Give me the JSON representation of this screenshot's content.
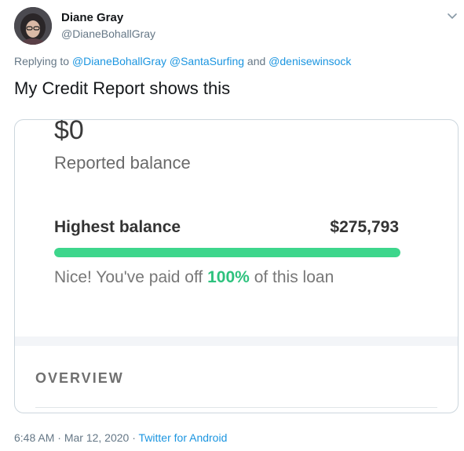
{
  "author": {
    "name": "Diane Gray",
    "handle": "@DianeBohallGray"
  },
  "reply": {
    "prefix": "Replying to",
    "mentions": [
      "@DianeBohallGray",
      "@SantaSurfing"
    ],
    "conjunction": "and",
    "last_mention": "@denisewinsock"
  },
  "tweet": {
    "text": "My Credit Report shows this"
  },
  "card": {
    "reported_amount": "$0",
    "reported_label": "Reported balance",
    "highest_label": "Highest balance",
    "highest_value": "$275,793",
    "paid_fraction": 1.0,
    "paid_prefix": "Nice! You've paid off",
    "paid_percent": "100%",
    "paid_suffix": "of this loan",
    "overview_label": "OVERVIEW"
  },
  "meta": {
    "time": "6:48 AM",
    "date": "Mar 12, 2020",
    "separator": "·",
    "source": "Twitter for Android"
  },
  "colors": {
    "progress": "#3dd68c",
    "link": "#1b95e0"
  },
  "icons": {
    "menu": "chevron-down-icon"
  }
}
